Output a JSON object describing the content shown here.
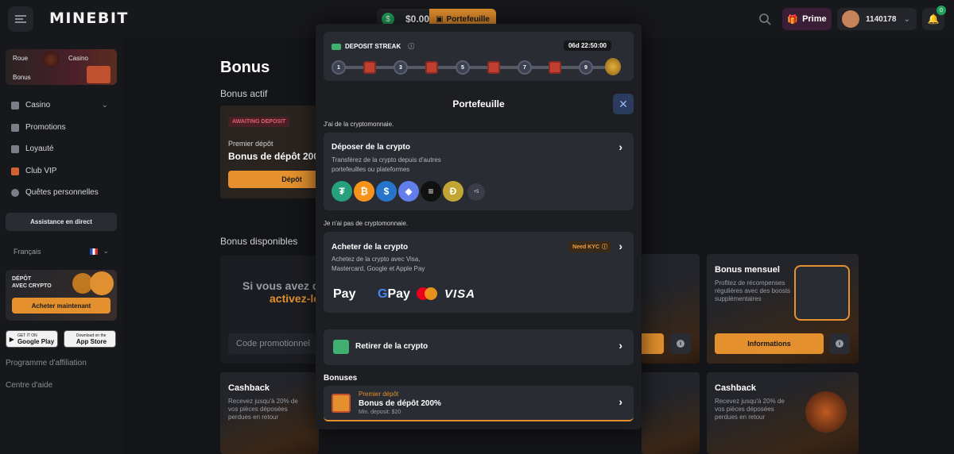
{
  "brand": {
    "logo_text": "MINEBIT",
    "accent": "#e4902e",
    "prime_color": "#3a1d36"
  },
  "header": {
    "balance": "$0.00",
    "wallet_label": "Portefeuille",
    "prime_label": "Prime",
    "username": "1140178",
    "notification_count": "0"
  },
  "sidebar": {
    "tiles": {
      "roue": "Roue",
      "casino": "Casino",
      "bonus": "Bonus"
    },
    "items": [
      {
        "label": "Casino",
        "icon": "spade-icon"
      },
      {
        "label": "Promotions",
        "icon": "flag-icon"
      },
      {
        "label": "Loyauté",
        "icon": "medal-icon"
      },
      {
        "label": "Club VIP",
        "icon": "crown-icon"
      },
      {
        "label": "Quêtes personnelles",
        "icon": "quest-icon"
      }
    ],
    "assist_label": "Assistance en direct",
    "language": "Français",
    "promo": {
      "line1": "DÉPÔT",
      "line2": "AVEC CRYPTO",
      "button": "Acheter maintenant"
    },
    "stores": {
      "google_small": "GET IT ON",
      "google": "Google Play",
      "apple_small": "Download on the",
      "apple": "App Store"
    },
    "links": {
      "affiliate": "Programme d'affiliation",
      "help": "Centre d'aide"
    }
  },
  "main": {
    "title": "Bonus",
    "active_heading": "Bonus actif",
    "active_card": {
      "badge": "AWAITING DEPOSIT",
      "kicker": "Premier dépôt",
      "title": "Bonus de dépôt 200",
      "button": "Dépôt"
    },
    "available_heading": "Bonus disponibles",
    "promo_line1": "Si vous avez de",
    "promo_line2": "activez-le",
    "promo_placeholder": "Code promotionnel",
    "monthly": {
      "title": "Bonus mensuel",
      "desc": "Profitez de récompenses régulières avec des boosts supplémentaires",
      "button": "Informations"
    },
    "cashback": {
      "title": "Cashback",
      "desc": "Recevez jusqu'à 20% de vos pièces déposées perdues en retour"
    }
  },
  "modal": {
    "streak": {
      "title": "DEPOSIT STREAK",
      "timer": "06d 22:50:00",
      "steps": [
        "1",
        "3",
        "5",
        "7",
        "9"
      ]
    },
    "title": "Portefeuille",
    "have_crypto_label": "J'ai de la cryptomonnaie.",
    "deposit": {
      "title": "Déposer de la crypto",
      "desc1": "Transférez de la crypto depuis d'autres",
      "desc2": "portefeuilles ou plateformes",
      "more": "+5",
      "coins": [
        {
          "name": "tether-icon",
          "glyph": "₮",
          "color": "#26a17b"
        },
        {
          "name": "bitcoin-icon",
          "glyph": "₿",
          "color": "#f7931a"
        },
        {
          "name": "usdc-icon",
          "glyph": "$",
          "color": "#2775ca"
        },
        {
          "name": "ethereum-icon",
          "glyph": "◆",
          "color": "#627eea"
        },
        {
          "name": "solana-icon",
          "glyph": "≡",
          "color": "#111111"
        },
        {
          "name": "dogecoin-icon",
          "glyph": "Ð",
          "color": "#c2a633"
        }
      ]
    },
    "no_crypto_label": "Je n'ai pas de cryptomonnaie.",
    "buy": {
      "title": "Acheter de la crypto",
      "kyc": "Need KYC",
      "desc1": "Achetez de la crypto avec Visa,",
      "desc2": "Mastercard, Google et Apple Pay",
      "apple_pay": "Pay",
      "google_pay": "Pay",
      "visa": "VISA"
    },
    "withdraw": {
      "title": "Retirer de la crypto"
    },
    "bonuses_label": "Bonuses",
    "bonus": {
      "kicker": "Premier dépôt",
      "title": "Bonus de dépôt 200%",
      "min": "Min. deposit: $20"
    }
  }
}
